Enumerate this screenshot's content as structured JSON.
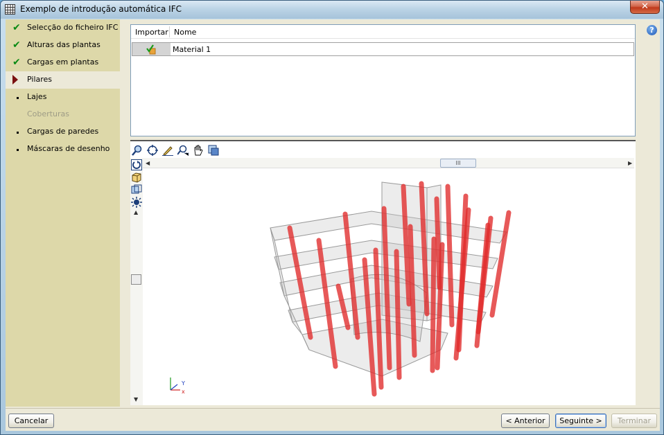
{
  "window": {
    "title": "Exemplo de introdução automática IFC",
    "close_glyph": "✕"
  },
  "steps": [
    {
      "label": "Selecção do ficheiro IFC",
      "state": "done"
    },
    {
      "label": "Alturas das plantas",
      "state": "done"
    },
    {
      "label": "Cargas em plantas",
      "state": "done"
    },
    {
      "label": "Pilares",
      "state": "current"
    },
    {
      "label": "Lajes",
      "state": "pending"
    },
    {
      "label": "Coberturas",
      "state": "disabled"
    },
    {
      "label": "Cargas de paredes",
      "state": "pending"
    },
    {
      "label": "Máscaras de desenho",
      "state": "pending"
    }
  ],
  "help": {
    "glyph": "?"
  },
  "table": {
    "columns": [
      "Importar",
      "Nome"
    ],
    "rows": [
      {
        "import_icon": "check-material-icon",
        "name": "Material 1"
      }
    ]
  },
  "viewer": {
    "toolbar_icons": [
      "zoom-rotate-icon",
      "zoom-extents-icon",
      "pencil-icon",
      "zoom-window-icon",
      "pan-hand-icon",
      "views-icon"
    ],
    "side_icons": [
      "rotate-icon",
      "cube-icon",
      "perspective-icon",
      "lighting-icon"
    ],
    "hscroll_thumb": "III",
    "axis_labels": {
      "x": "x",
      "y": "Y"
    },
    "colors": {
      "column": "#e02a2a",
      "slab": "#c8c8c8"
    }
  },
  "footer": {
    "cancel": "Cancelar",
    "previous": "< Anterior",
    "next": "Seguinte >",
    "finish": "Terminar"
  }
}
